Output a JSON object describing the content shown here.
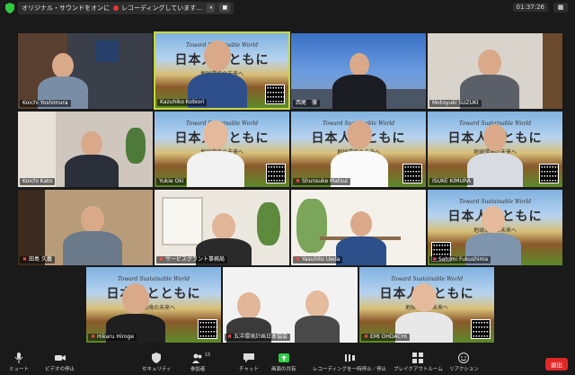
{
  "topbar": {
    "audio_label": "オリジナル・サウンドをオンにする",
    "recording_label": "レコーディングしています...",
    "pause_label": "⏸",
    "stop_label": "■",
    "timer": "01:37:26",
    "view_label": "表示"
  },
  "participants": [
    {
      "name": "Koichi Yoshimura",
      "muted": false
    },
    {
      "name": "Kazuhiko Kobiori",
      "muted": false
    },
    {
      "name": "西尾　徹",
      "muted": false
    },
    {
      "name": "Motoyuki SUZUKI",
      "muted": false
    },
    {
      "name": "Koichi Kato",
      "muted": false
    },
    {
      "name": "Yukie Oki",
      "muted": false
    },
    {
      "name": "Shunsuke Matsui",
      "muted": true
    },
    {
      "name": "ISUKE KIMURA",
      "muted": false
    },
    {
      "name": "田島 久義",
      "muted": true
    },
    {
      "name": "サービスグラント事務局",
      "muted": true
    },
    {
      "name": "Yasuhito Ueda",
      "muted": true
    },
    {
      "name": "Satomi Fukushima",
      "muted": true
    },
    {
      "name": "Hikaru Hiroge",
      "muted": true
    },
    {
      "name": "五洋環境計画日本協会",
      "muted": true
    },
    {
      "name": "EMI OHDACHI",
      "muted": true
    }
  ],
  "poster": {
    "line1": "Toward Sustainable World",
    "line2": "日本人とともに",
    "line3": "地球環境の未来へ"
  },
  "toolbar": {
    "mute": "ミュート",
    "video": "ビデオの停止",
    "security": "セキュリティ",
    "participants": "参加者",
    "participants_count": "15",
    "chat": "チャット",
    "share": "画面の共有",
    "record": "レコーディングを一時停止／停止",
    "breakout": "ブレイクアウトルーム",
    "reaction": "リアクション",
    "leave": "退出"
  },
  "colors": {
    "speaker_border": "#c7d83a",
    "share_green": "#2ecc40",
    "leave_red": "#e02828"
  }
}
